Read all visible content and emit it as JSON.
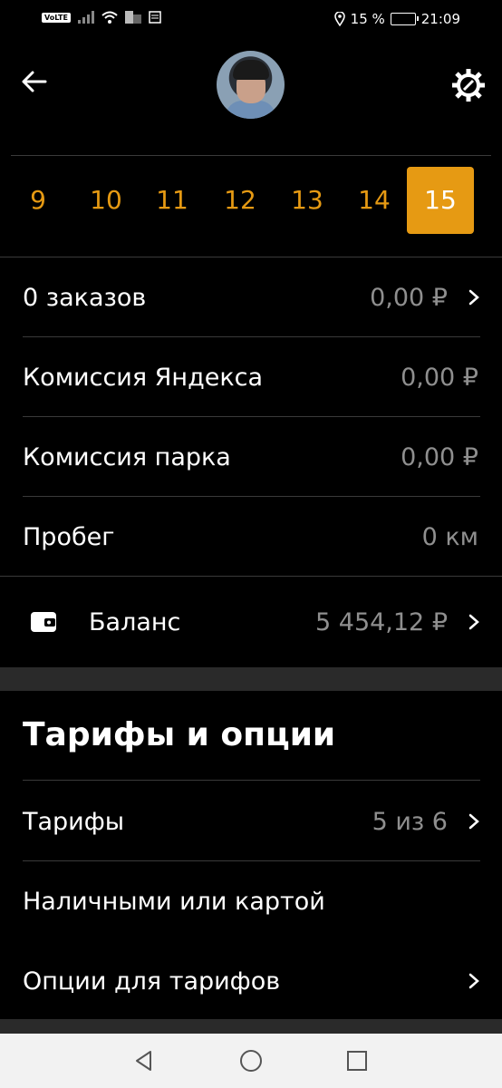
{
  "status_bar": {
    "volte": "VoLTE",
    "battery_percent": "15 %",
    "time": "21:09"
  },
  "days": [
    {
      "label": "9",
      "active": false
    },
    {
      "label": "10",
      "active": false
    },
    {
      "label": "11",
      "active": false
    },
    {
      "label": "12",
      "active": false
    },
    {
      "label": "13",
      "active": false
    },
    {
      "label": "14",
      "active": false
    },
    {
      "label": "15",
      "active": true
    }
  ],
  "stats": {
    "orders_label": "0 заказов",
    "orders_value": "0,00 ₽",
    "yandex_fee_label": "Комиссия Яндекса",
    "yandex_fee_value": "0,00 ₽",
    "park_fee_label": "Комиссия парка",
    "park_fee_value": "0,00 ₽",
    "mileage_label": "Пробег",
    "mileage_value": "0 км"
  },
  "balance": {
    "label": "Баланс",
    "value": "5 454,12 ₽"
  },
  "tariffs_section": {
    "title": "Тарифы и опции",
    "tariffs_label": "Тарифы",
    "tariffs_value": "5 из 6",
    "payment_label": "Наличными или картой",
    "options_label": "Опции для тарифов"
  },
  "icons": {
    "back": "arrow-left-icon",
    "settings": "gear-icon",
    "wallet": "wallet-icon",
    "chevron": "chevron-right-icon"
  },
  "colors": {
    "accent": "#e69a13",
    "background": "#000000",
    "muted_text": "#8f8f8f"
  }
}
